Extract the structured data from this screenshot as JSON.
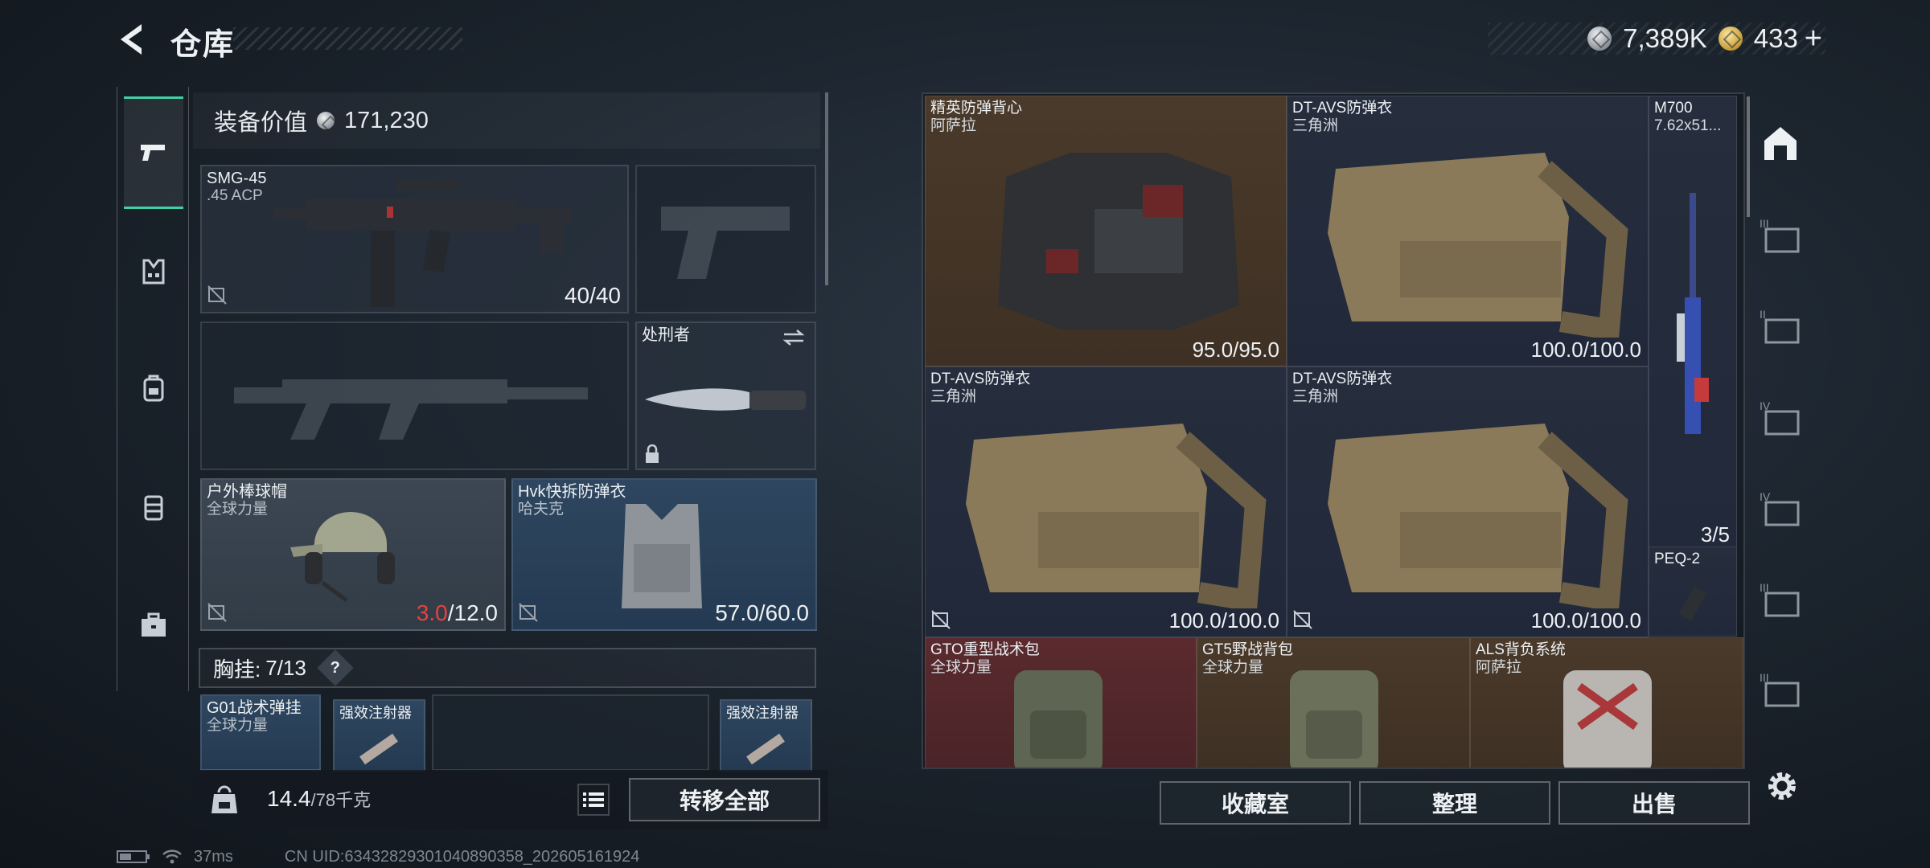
{
  "header": {
    "title": "仓库",
    "currency": [
      {
        "icon": "silver-coin-icon",
        "value": "7,389K"
      },
      {
        "icon": "gold-coin-icon",
        "value": "433",
        "plus": "+"
      }
    ]
  },
  "loadout": {
    "equip_value_label": "装备价值",
    "equip_value": "171,230",
    "weapon_primary": {
      "name": "SMG-45",
      "ammo": ".45 ACP",
      "durability": "40/40"
    },
    "melee": {
      "name": "处刑者"
    },
    "helmet": {
      "name": "户外棒球帽",
      "brand": "全球力量",
      "dur_current": "3.0",
      "dur_max": "/12.0"
    },
    "armor": {
      "name": "Hvk快拆防弹衣",
      "brand": "哈夫克",
      "durability": "57.0/60.0"
    },
    "chest_rig_label": "胸挂:",
    "chest_rig_count": "7/13",
    "chest_rig_help": "?",
    "rig_items": [
      {
        "name": "G01战术弹挂",
        "brand": "全球力量"
      },
      {
        "name": "强效注射器"
      },
      {
        "name": "强效注射器"
      }
    ],
    "weight": "14.4",
    "weight_max": "/78千克",
    "transfer_all": "转移全部"
  },
  "stash": {
    "items": [
      {
        "name": "精英防弹背心",
        "brand": "阿萨拉",
        "durability": "95.0/95.0"
      },
      {
        "name": "DT-AVS防弹衣",
        "brand": "三角洲",
        "durability": "100.0/100.0"
      },
      {
        "name": "M700",
        "ammo": "7.62x51...",
        "count": "3/5"
      },
      {
        "name": "DT-AVS防弹衣",
        "brand": "三角洲",
        "durability": "100.0/100.0"
      },
      {
        "name": "DT-AVS防弹衣",
        "brand": "三角洲",
        "durability": "100.0/100.0"
      },
      {
        "name": "PEQ-2"
      },
      {
        "name": "GTO重型战术包",
        "brand": "全球力量"
      },
      {
        "name": "GT5野战背包",
        "brand": "全球力量"
      },
      {
        "name": "ALS背负系统",
        "brand": "阿萨拉"
      }
    ],
    "buttons": {
      "collection": "收藏室",
      "sort": "整理",
      "sell": "出售"
    }
  },
  "sidebar_tiers": [
    "III",
    "II",
    "IV",
    "IV",
    "III",
    "III"
  ],
  "status": {
    "ping": "37ms",
    "uid": "CN UID:63432829301040890358_202605161924"
  },
  "colors": {
    "accent": "#3fd0a5",
    "durability_low": "#e8413c"
  }
}
